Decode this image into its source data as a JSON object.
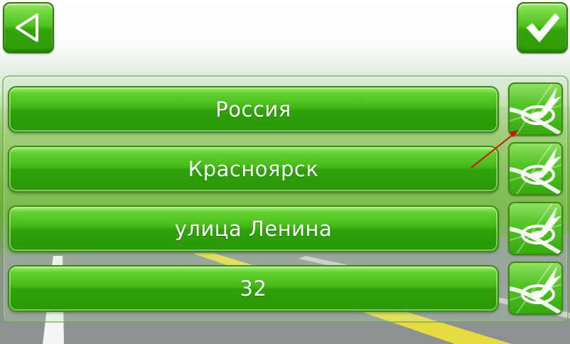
{
  "toolbar": {
    "back_icon": "back-triangle-icon",
    "ok_icon": "checkmark-icon"
  },
  "address": {
    "rows": [
      {
        "label": "Россия",
        "action_icon": "map-pick-icon"
      },
      {
        "label": "Красноярск",
        "action_icon": "map-pick-icon"
      },
      {
        "label": "улица Ленина",
        "action_icon": "map-pick-icon"
      },
      {
        "label": "32",
        "action_icon": "map-pick-icon"
      }
    ]
  },
  "colors": {
    "button_green": "#3aaa12",
    "button_border": "#2f7a0a",
    "text": "#ffffff",
    "annotation_arrow": "#d01010"
  }
}
